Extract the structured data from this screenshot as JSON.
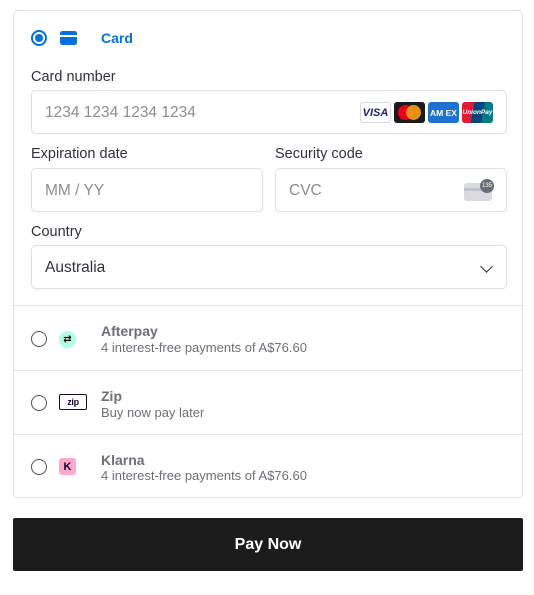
{
  "card_tab": {
    "label": "Card",
    "selected": true
  },
  "card_number": {
    "label": "Card number",
    "placeholder": "1234 1234 1234 1234",
    "brands": [
      "VISA",
      "Mastercard",
      "AMEX",
      "UnionPay"
    ],
    "brand_text": {
      "visa": "VISA",
      "amex": "AM EX",
      "unionpay": "UnionPay"
    }
  },
  "expiration": {
    "label": "Expiration date",
    "placeholder": "MM / YY"
  },
  "security": {
    "label": "Security code",
    "placeholder": "CVC",
    "icon_badge": "135"
  },
  "country": {
    "label": "Country",
    "value": "Australia"
  },
  "options": [
    {
      "id": "afterpay",
      "title": "Afterpay",
      "subtitle": "4 interest-free payments of A$76.60",
      "logo": "afterpay-logo"
    },
    {
      "id": "zip",
      "title": "Zip",
      "subtitle": "Buy now pay later",
      "logo": "zip-logo",
      "logo_text": "zip"
    },
    {
      "id": "klarna",
      "title": "Klarna",
      "subtitle": "4 interest-free payments of A$76.60",
      "logo": "klarna-logo",
      "logo_text": "K"
    }
  ],
  "pay_button": {
    "label": "Pay Now"
  },
  "colors": {
    "accent": "#0570de",
    "button_bg": "#1c1c1c",
    "muted_text": "#6d6e78"
  }
}
